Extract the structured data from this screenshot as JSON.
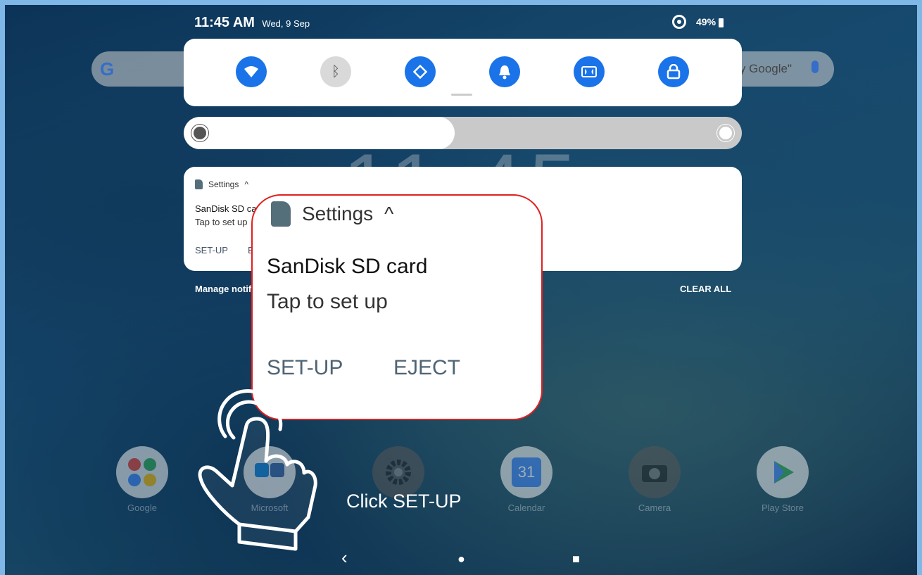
{
  "status_bar": {
    "time": "11:45 AM",
    "date": "Wed, 9 Sep",
    "battery": "49%"
  },
  "search": {
    "logo": "G",
    "hint": "y Google\""
  },
  "quick_settings": {
    "tiles": [
      {
        "icon": "wifi-icon",
        "glyph": "▼",
        "state": "on"
      },
      {
        "icon": "bluetooth-icon",
        "glyph": "ᛒ",
        "state": "off"
      },
      {
        "icon": "auto-rotate-icon",
        "glyph": "⟳",
        "state": "on"
      },
      {
        "icon": "bell-icon",
        "glyph": "🔔",
        "state": "on"
      },
      {
        "icon": "dolby-icon",
        "glyph": "◧",
        "state": "on"
      },
      {
        "icon": "lock-rotation-icon",
        "glyph": "🔓",
        "state": "on"
      }
    ]
  },
  "brightness": {
    "level": 0.49
  },
  "lock_clock": "11:45",
  "notification": {
    "app": "Settings",
    "chevron": "^",
    "title": "SanDisk SD card",
    "text": "Tap to set up",
    "action_setup": "SET-UP",
    "action_eject": "E"
  },
  "footer": {
    "manage": "Manage notif",
    "clear": "CLEAR ALL"
  },
  "dock": [
    {
      "label": "Google"
    },
    {
      "label": "Microsoft"
    },
    {
      "label": ""
    },
    {
      "label": "Calendar",
      "badge": "31"
    },
    {
      "label": "Camera"
    },
    {
      "label": "Play Store"
    }
  ],
  "callout": {
    "app": "Settings",
    "chevron": "^",
    "title": "SanDisk SD card",
    "text": "Tap to set up",
    "action_setup": "SET-UP",
    "action_eject": "EJECT"
  },
  "caption": "Click SET-UP",
  "nav": {
    "back": "‹",
    "home": "●",
    "recents": "■"
  }
}
